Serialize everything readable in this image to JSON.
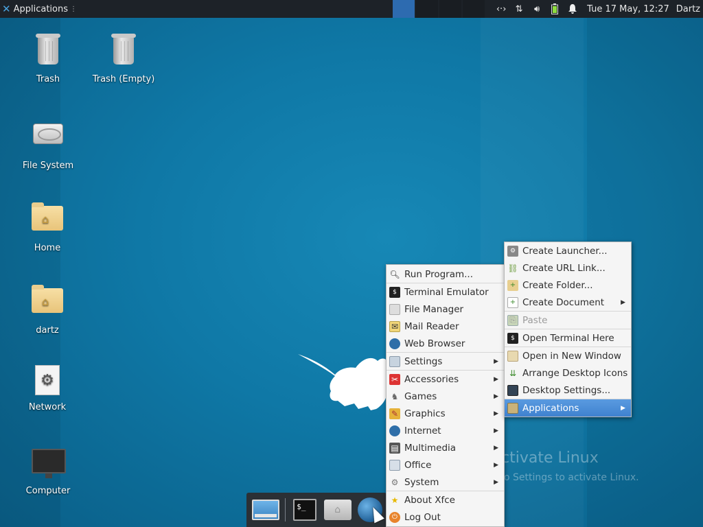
{
  "top_panel": {
    "applications_label": "Applications",
    "clock": "Tue 17 May, 12:27",
    "user": "Dartz"
  },
  "desktop_icons": [
    {
      "label": "Trash"
    },
    {
      "label": "Trash (Empty)"
    },
    {
      "label": "File System"
    },
    {
      "label": "Home"
    },
    {
      "label": "dartz"
    },
    {
      "label": "Network"
    },
    {
      "label": "Computer"
    }
  ],
  "applications_menu": {
    "items": [
      {
        "label": "Run Program...",
        "icon": "search-icon"
      },
      {
        "label": "Terminal Emulator",
        "icon": "terminal-icon"
      },
      {
        "label": "File Manager",
        "icon": "folder-icon"
      },
      {
        "label": "Mail Reader",
        "icon": "mail-icon"
      },
      {
        "label": "Web Browser",
        "icon": "globe-icon"
      },
      {
        "label": "Settings",
        "icon": "settings-icon"
      },
      {
        "label": "Accessories",
        "icon": "accessories-icon"
      },
      {
        "label": "Games",
        "icon": "games-icon"
      },
      {
        "label": "Graphics",
        "icon": "graphics-icon"
      },
      {
        "label": "Internet",
        "icon": "internet-icon"
      },
      {
        "label": "Multimedia",
        "icon": "multimedia-icon"
      },
      {
        "label": "Office",
        "icon": "office-icon"
      },
      {
        "label": "System",
        "icon": "system-icon"
      },
      {
        "label": "About Xfce",
        "icon": "star-icon"
      },
      {
        "label": "Log Out",
        "icon": "logout-icon"
      }
    ]
  },
  "desktop_menu": {
    "items": [
      {
        "label": "Create Launcher...",
        "icon": "launcher-icon"
      },
      {
        "label": "Create URL Link...",
        "icon": "link-icon"
      },
      {
        "label": "Create Folder...",
        "icon": "new-folder-icon"
      },
      {
        "label": "Create Document",
        "icon": "new-document-icon"
      },
      {
        "label": "Paste",
        "icon": "paste-icon",
        "disabled": true
      },
      {
        "label": "Open Terminal Here",
        "icon": "terminal-icon"
      },
      {
        "label": "Open in New Window",
        "icon": "folder-icon"
      },
      {
        "label": "Arrange Desktop Icons",
        "icon": "arrange-icon"
      },
      {
        "label": "Desktop Settings...",
        "icon": "monitor-icon"
      },
      {
        "label": "Applications",
        "icon": "applications-icon",
        "selected": true
      }
    ]
  },
  "watermark": {
    "title": "ctivate Linux",
    "subtitle": "o Settings to activate Linux."
  },
  "colors": {
    "panel_bg": "#1d2228",
    "desktop_bg": "#0f78a6",
    "menu_bg": "#f5f5f5",
    "selection": "#3f82cf",
    "workspace_active": "#2d6bb0"
  }
}
